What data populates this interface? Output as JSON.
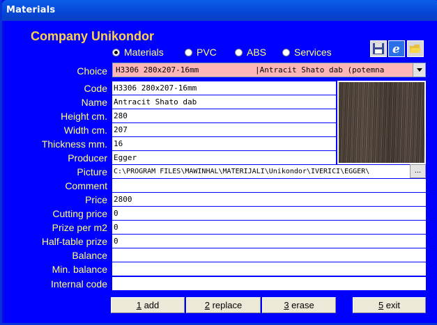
{
  "window": {
    "title": "Materials"
  },
  "company": "Company Unikondor",
  "radios": [
    {
      "label": "Materials",
      "selected": true
    },
    {
      "label": "PVC",
      "selected": false
    },
    {
      "label": "ABS",
      "selected": false
    },
    {
      "label": "Services",
      "selected": false
    }
  ],
  "toolbar": {
    "icons": [
      "floppy-disk-icon",
      "internet-explorer-icon",
      "open-folder-icon"
    ]
  },
  "choice": {
    "label": "Choice",
    "col1": "H3306 280x207-16mm",
    "col2": "|Antracit Shato dab (potemna"
  },
  "labels": {
    "code": "Code",
    "name": "Name",
    "height": "Height cm.",
    "width": "Width cm.",
    "thickness": "Thickness mm.",
    "producer": "Producer",
    "picture": "Picture",
    "comment": "Comment",
    "price": "Price",
    "cutting": "Cutting price",
    "m2": "Prize per m2",
    "half": "Half-table prize",
    "balance": "Balance",
    "minbalance": "Min. balance",
    "internal": "Internal code"
  },
  "values": {
    "code": "H3306 280x207-16mm",
    "name": "Antracit Shato dab",
    "height": "280",
    "width": "207",
    "thickness": "16",
    "producer": "Egger",
    "picture": "C:\\PROGRAM FILES\\MAWINHAL\\MATERIJALI\\Unikondor\\IVERICI\\EGGER\\",
    "comment": "",
    "price": "2800",
    "cutting": "0",
    "m2": "0",
    "half": "0",
    "balance": "",
    "minbalance": "",
    "internal": ""
  },
  "browse_label": "...",
  "buttons": [
    {
      "key": "1",
      "label": " add"
    },
    {
      "key": "2",
      "label": " replace"
    },
    {
      "key": "3",
      "label": " erase"
    },
    {
      "key": "5",
      "label": " exit"
    }
  ],
  "colors": {
    "background": "#0000ff",
    "label": "#ffff80",
    "company": "#ffd24a",
    "choice_bg": "#ffb6b6"
  }
}
